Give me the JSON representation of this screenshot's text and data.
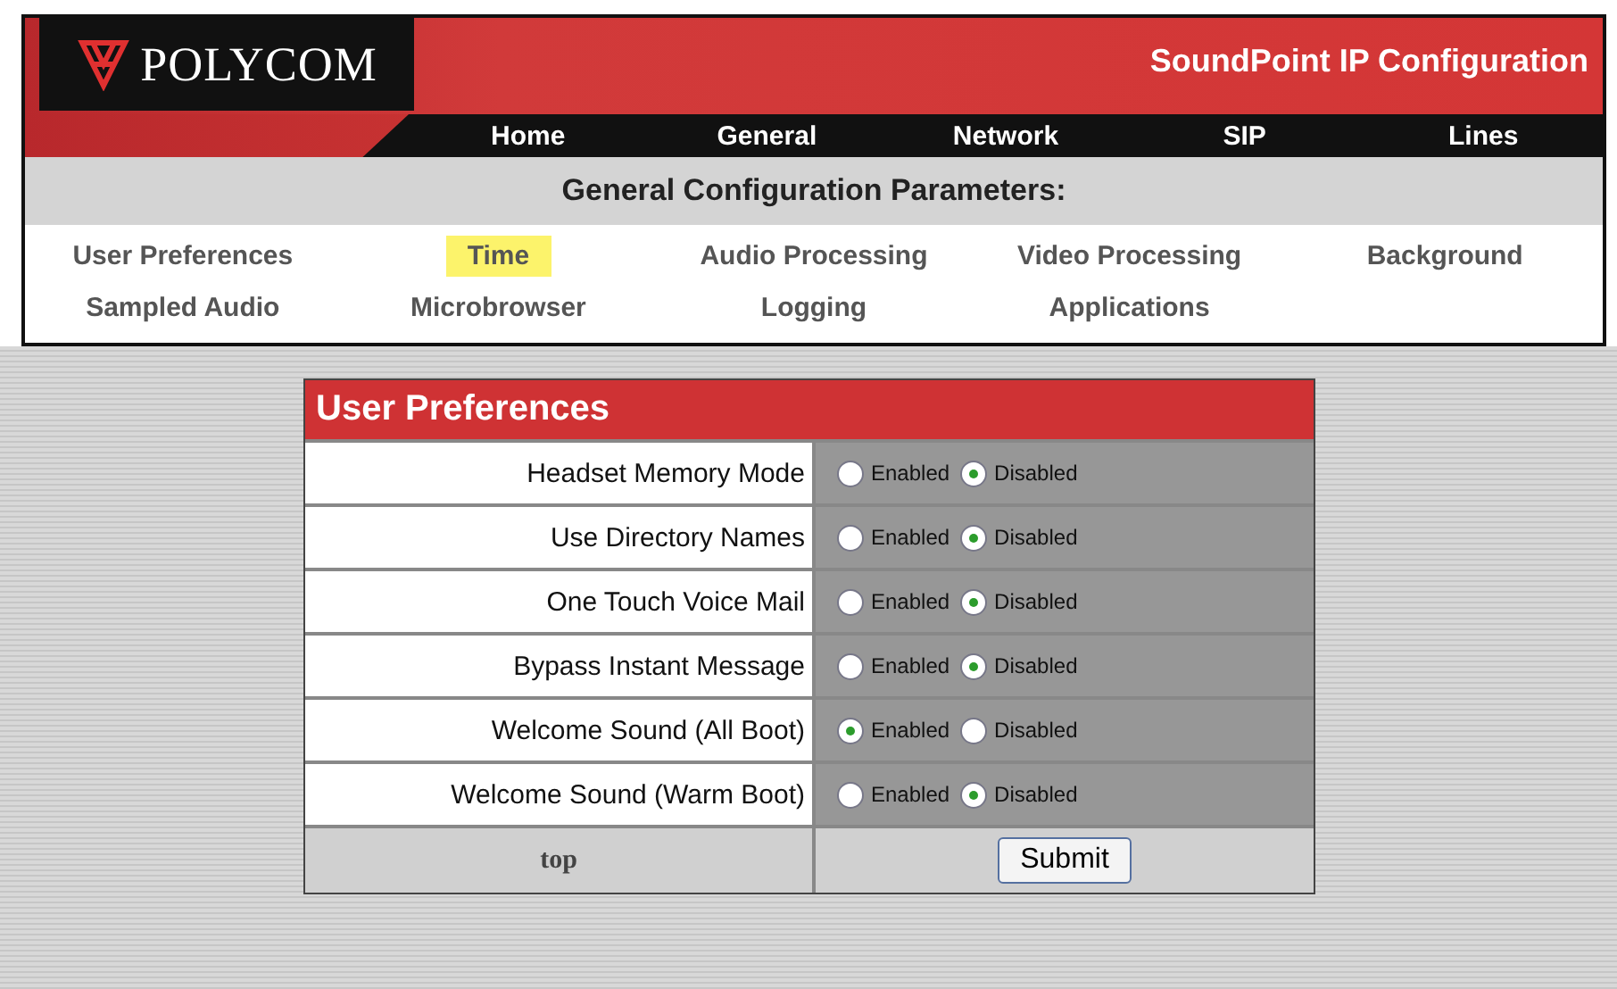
{
  "header": {
    "logo_text": "POLYCOM",
    "title": "SoundPoint IP Configuration"
  },
  "nav": [
    {
      "label": "Home"
    },
    {
      "label": "General"
    },
    {
      "label": "Network"
    },
    {
      "label": "SIP"
    },
    {
      "label": "Lines"
    }
  ],
  "section_title": "General Configuration Parameters:",
  "submenu": [
    {
      "label": "User Preferences",
      "selected": false
    },
    {
      "label": "Time",
      "selected": true
    },
    {
      "label": "Audio Processing",
      "selected": false
    },
    {
      "label": "Video Processing",
      "selected": false
    },
    {
      "label": "Background",
      "selected": false
    },
    {
      "label": "Sampled Audio",
      "selected": false
    },
    {
      "label": "Microbrowser",
      "selected": false
    },
    {
      "label": "Logging",
      "selected": false
    },
    {
      "label": "Applications",
      "selected": false
    }
  ],
  "panel": {
    "title": "User Preferences",
    "rows": [
      {
        "label": "Headset Memory Mode",
        "options": [
          {
            "label": "Enabled",
            "selected": false
          },
          {
            "label": "Disabled",
            "selected": true
          }
        ]
      },
      {
        "label": "Use Directory Names",
        "options": [
          {
            "label": "Enabled",
            "selected": false
          },
          {
            "label": "Disabled",
            "selected": true
          }
        ]
      },
      {
        "label": "One Touch Voice Mail",
        "options": [
          {
            "label": "Enabled",
            "selected": false
          },
          {
            "label": "Disabled",
            "selected": true
          }
        ]
      },
      {
        "label": "Bypass Instant Message",
        "options": [
          {
            "label": "Enabled",
            "selected": false
          },
          {
            "label": "Disabled",
            "selected": true
          }
        ]
      },
      {
        "label": "Welcome Sound (All Boot)",
        "options": [
          {
            "label": "Enabled",
            "selected": true
          },
          {
            "label": "Disabled",
            "selected": false
          }
        ]
      },
      {
        "label": "Welcome Sound (Warm Boot)",
        "options": [
          {
            "label": "Enabled",
            "selected": false
          },
          {
            "label": "Disabled",
            "selected": true
          }
        ]
      }
    ],
    "top_link": "top",
    "submit": "Submit"
  }
}
